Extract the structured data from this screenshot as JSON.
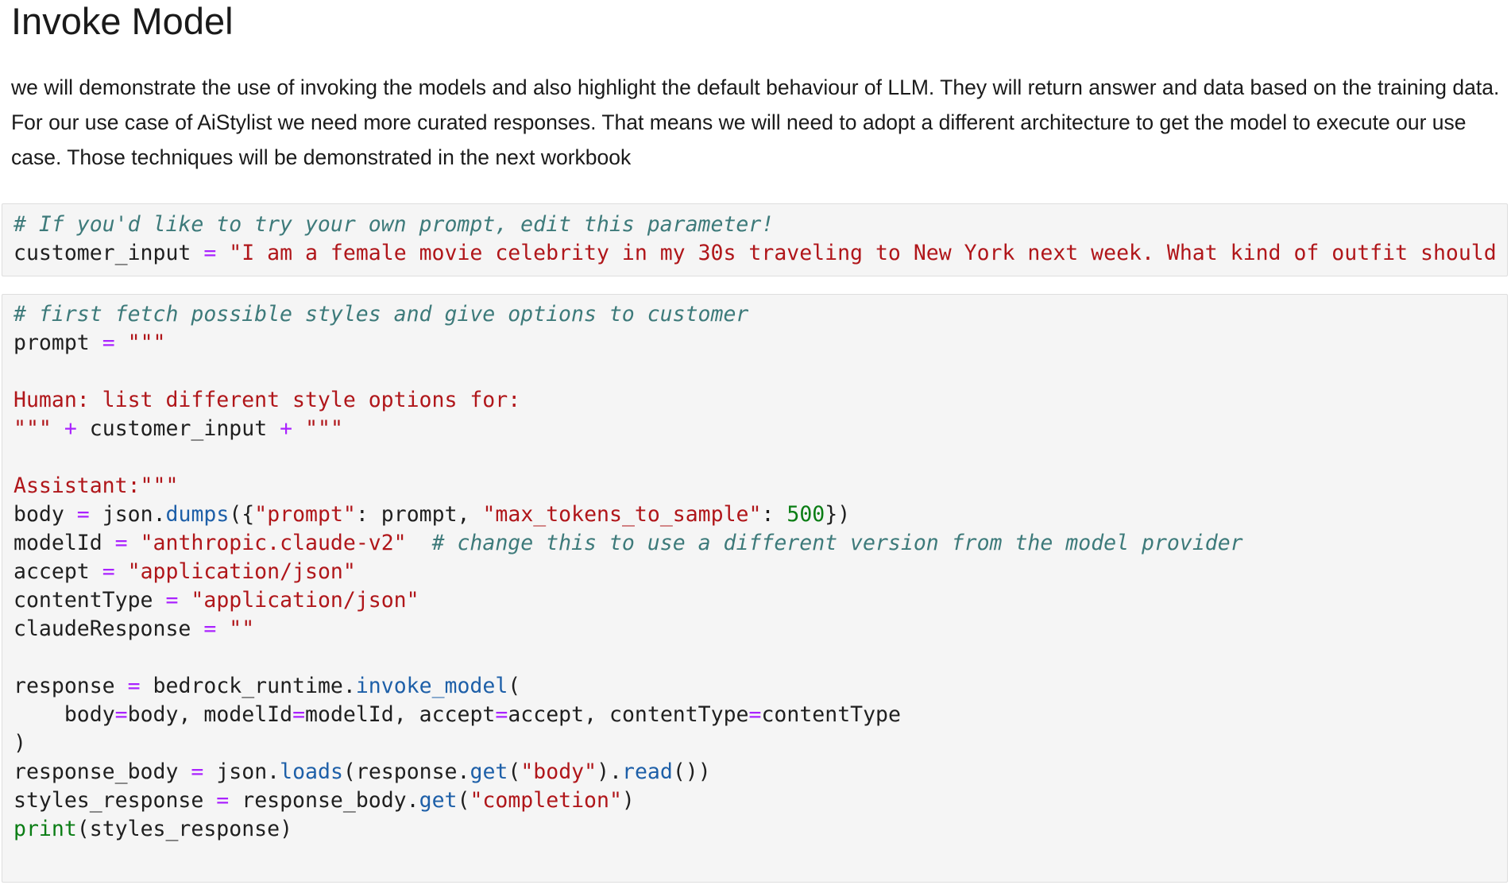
{
  "heading": "Invoke Model",
  "intro": "we will demonstrate the use of invoking the models and also highlight the default behaviour of LLM. They will return answer and data based on the training data. For our use case of AiStylist we need more curated responses. That means we will need to adopt a different architecture to get the model to execute our use case. Those techniques will be demonstrated in the next workbook",
  "cell1": {
    "comment": "# If you'd like to try your own prompt, edit this parameter!",
    "var": "customer_input",
    "eq": "=",
    "value": "\"I am a female movie celebrity in my 30s traveling to New York next week. What kind of outfit should I"
  },
  "cell2": {
    "l1_comment": "# first fetch possible styles and give options to customer",
    "l2_var": "prompt",
    "l2_eq": "=",
    "l2_str": "\"\"\"",
    "l4_str": "Human: list different style options for:",
    "l5_str_a": "\"\"\"",
    "l5_op_a": "+",
    "l5_var": "customer_input",
    "l5_op_b": "+",
    "l5_str_b": "\"\"\"",
    "l7_str": "Assistant:\"\"\"",
    "l8_var": "body",
    "l8_eq": "=",
    "l8_mod": "json",
    "l8_fn": "dumps",
    "l8_key1": "\"prompt\"",
    "l8_arg1": "prompt",
    "l8_key2": "\"max_tokens_to_sample\"",
    "l8_num": "500",
    "l9_var": "modelId",
    "l9_eq": "=",
    "l9_str": "\"anthropic.claude-v2\"",
    "l9_comment": "# change this to use a different version from the model provider",
    "l10_var": "accept",
    "l10_eq": "=",
    "l10_str": "\"application/json\"",
    "l11_var": "contentType",
    "l11_eq": "=",
    "l11_str": "\"application/json\"",
    "l12_var": "claudeResponse",
    "l12_eq": "=",
    "l12_str": "\"\"",
    "l14_var": "response",
    "l14_eq": "=",
    "l14_obj": "bedrock_runtime",
    "l14_fn": "invoke_model",
    "l15_k1": "body",
    "l15_v1": "body",
    "l15_k2": "modelId",
    "l15_v2": "modelId",
    "l15_k3": "accept",
    "l15_v3": "accept",
    "l15_k4": "contentType",
    "l15_v4": "contentType",
    "l16_close": ")",
    "l17_var": "response_body",
    "l17_eq": "=",
    "l17_mod": "json",
    "l17_fn": "loads",
    "l17_obj": "response",
    "l17_get": "get",
    "l17_str": "\"body\"",
    "l17_read": "read",
    "l18_var": "styles_response",
    "l18_eq": "=",
    "l18_obj": "response_body",
    "l18_get": "get",
    "l18_str": "\"completion\"",
    "l19_print": "print",
    "l19_arg": "styles_response"
  }
}
